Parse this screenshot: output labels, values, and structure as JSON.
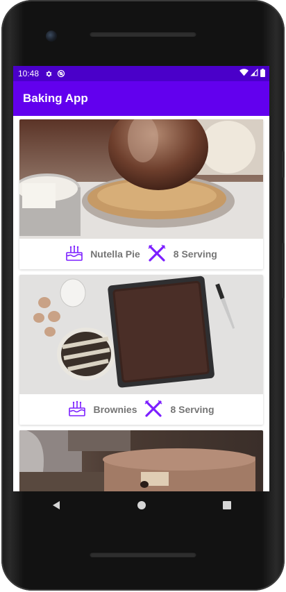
{
  "status_bar": {
    "time": "10:48",
    "icons": [
      "gear-icon",
      "at-sign-icon",
      "wifi-icon",
      "signal-icon",
      "battery-icon"
    ]
  },
  "app_bar": {
    "title": "Baking App"
  },
  "recipes": [
    {
      "name": "Nutella Pie",
      "servings": "8 Serving",
      "image": "pie-crust-photo"
    },
    {
      "name": "Brownies",
      "servings": "8 Serving",
      "image": "brownies-pan-photo"
    },
    {
      "name": "",
      "servings": "",
      "image": "frosted-cake-photo"
    }
  ],
  "icons": {
    "cake": "cake-icon",
    "utensils": "fork-knife-icon"
  },
  "colors": {
    "primary": "#6200ee",
    "primary_dark": "#4a00c9",
    "icon_accent": "#7c1fff",
    "text_gray": "#757575"
  },
  "nav_bar": [
    "back-button",
    "home-button",
    "recents-button"
  ]
}
